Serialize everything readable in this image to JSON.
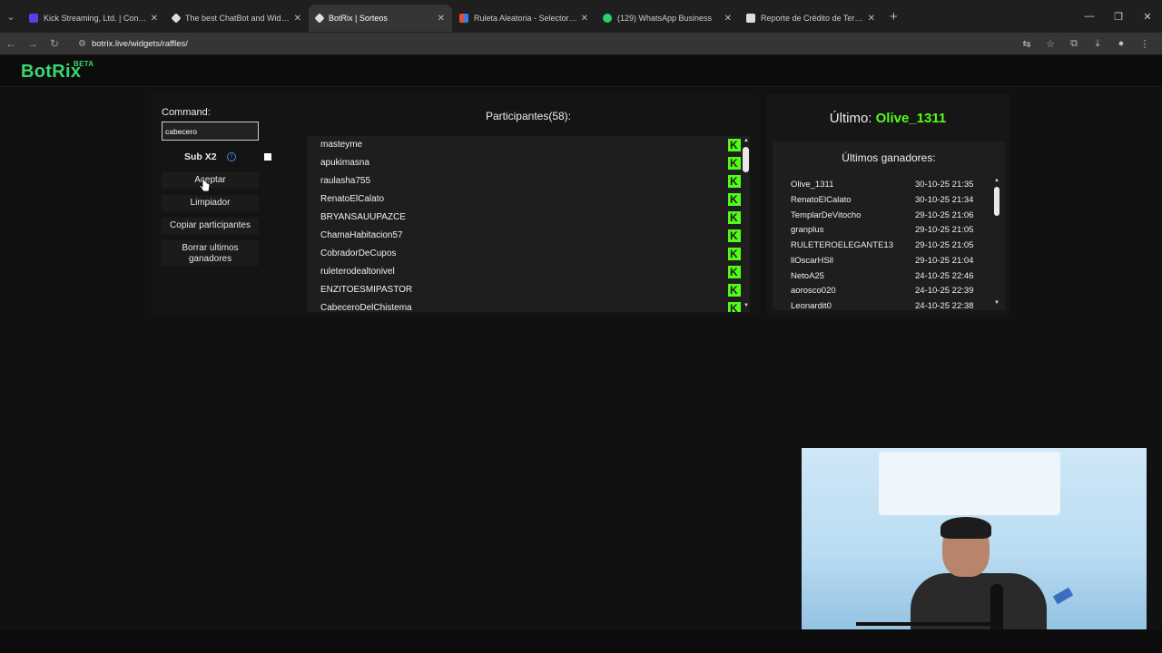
{
  "browser": {
    "tabs": [
      {
        "title": "Kick Streaming, Ltd. | Configura",
        "color": "#5b3ee8"
      },
      {
        "title": "The best ChatBot and Widgets",
        "color": "#dddddd"
      },
      {
        "title": "BotRix | Sorteos",
        "color": "#dddddd"
      },
      {
        "title": "Ruleta Aleatoria - Selector Pers",
        "color": "#e84a3a"
      },
      {
        "title": "(129) WhatsApp Business",
        "color": "#25d366"
      },
      {
        "title": "Reporte de Crédito de Terceros",
        "color": "#dddddd"
      }
    ],
    "url": "botrix.live/widgets/raffles/"
  },
  "site": {
    "logo": "BotRix",
    "logo_badge": "BETA"
  },
  "controls": {
    "command_label": "Command:",
    "command_value": "cabecero",
    "sub_label": "Sub X2",
    "buttons": {
      "accept": "Aceptar",
      "clear": "Limpiador",
      "copy": "Copiar participantes",
      "delete_winners": "Borrar ultimos ganadores"
    }
  },
  "participants": {
    "title": "Participantes(58):",
    "items": [
      "masteyme",
      "apukimasna",
      "raulasha755",
      "RenatoElCalato",
      "BRYANSAUUPAZCE",
      "ChamaHabitacion57",
      "CobradorDeCupos",
      "ruleterodealtonivel",
      "ENZITOESMIPASTOR",
      "CabeceroDelChistema"
    ]
  },
  "winners": {
    "last_label": "Último:",
    "last_name": "Olive_1311",
    "title": "Últimos ganadores:",
    "items": [
      {
        "name": "Olive_1311",
        "date": "30-10-25 21:35"
      },
      {
        "name": "RenatoElCalato",
        "date": "30-10-25 21:34"
      },
      {
        "name": "TemplarDeVitocho",
        "date": "29-10-25 21:06"
      },
      {
        "name": "granplus",
        "date": "29-10-25 21:05"
      },
      {
        "name": "RULETEROELEGANTE13",
        "date": "29-10-25 21:05"
      },
      {
        "name": "llOscarHSll",
        "date": "29-10-25 21:04"
      },
      {
        "name": "NetoA25",
        "date": "24-10-25 22:46"
      },
      {
        "name": "aorosco020",
        "date": "24-10-25 22:39"
      },
      {
        "name": "Leonardit0",
        "date": "24-10-25 22:38"
      }
    ]
  },
  "accent": "#53fc18"
}
